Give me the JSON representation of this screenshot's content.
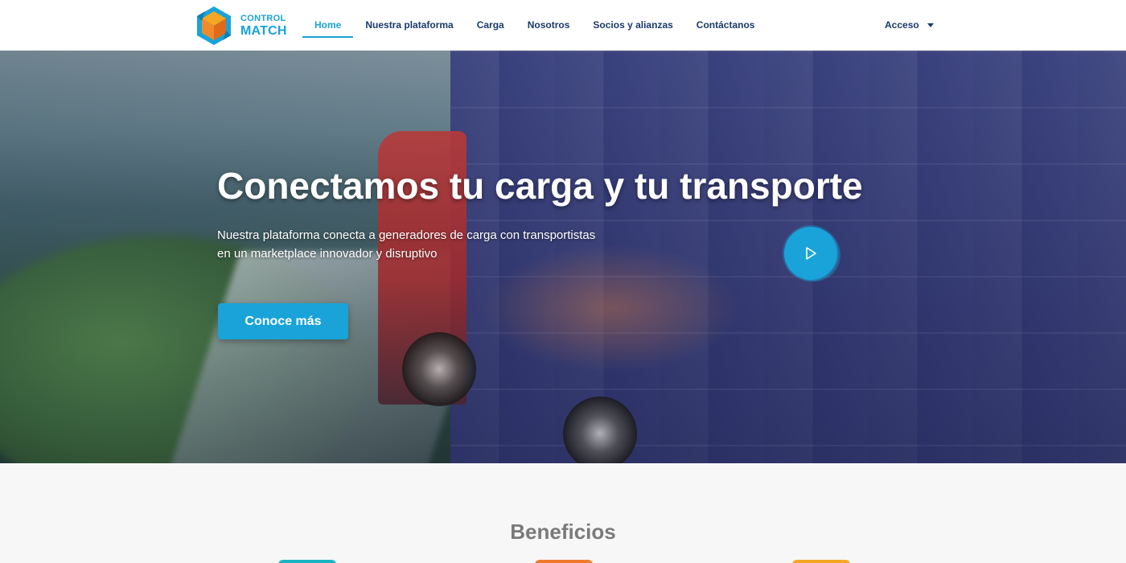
{
  "header": {
    "logo": {
      "line1": "CONTROL",
      "line2": "MATCH"
    },
    "nav": [
      {
        "label": "Home",
        "active": true
      },
      {
        "label": "Nuestra plataforma",
        "active": false
      },
      {
        "label": "Carga",
        "active": false
      },
      {
        "label": "Nosotros",
        "active": false
      },
      {
        "label": "Socios y alianzas",
        "active": false
      },
      {
        "label": "Contáctanos",
        "active": false
      }
    ],
    "access": {
      "label": "Acceso",
      "icon": "caret-down-icon"
    }
  },
  "hero": {
    "title": "Conectamos tu carga y tu transporte",
    "subtitle_line1": "Nuestra plataforma conecta a generadores de carga con transportistas",
    "subtitle_line2": "en un marketplace innovador y disruptivo",
    "cta_label": "Conoce más",
    "play_icon": "play-icon"
  },
  "benefits": {
    "title": "Beneficios",
    "icon_colors": [
      "#1ab5c4",
      "#f07a2c",
      "#f5a623"
    ]
  },
  "colors": {
    "accent": "#1aa3d9",
    "nav_text": "#1a3a6b",
    "logo_orange": "#f08a2c"
  }
}
